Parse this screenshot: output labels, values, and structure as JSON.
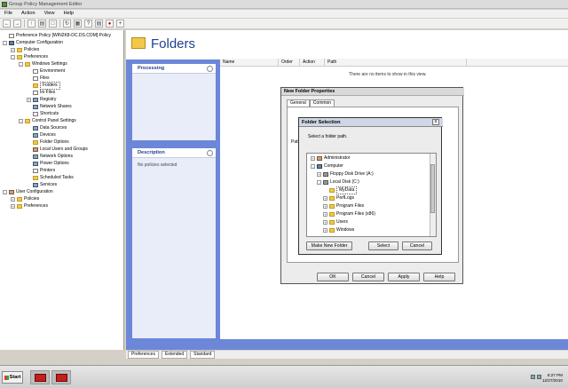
{
  "window": {
    "title": "Group Policy Management Editor"
  },
  "menu": [
    "File",
    "Action",
    "View",
    "Help"
  ],
  "toolbar_icons": [
    "back-icon",
    "forward-icon",
    "up-icon",
    "show-hide-tree-icon",
    "properties-icon",
    "refresh-icon",
    "export-icon",
    "help-icon",
    "filter-icon",
    "stop-icon",
    "add-icon"
  ],
  "tree": [
    {
      "label": "Preference Policy [WIN2K8-DC.DS.COM] Policy",
      "level": 0,
      "icon": "doc"
    },
    {
      "label": "Computer Configuration",
      "level": 0,
      "icon": "pc",
      "exp": "-"
    },
    {
      "label": "Policies",
      "level": 1,
      "icon": "fold",
      "exp": "+"
    },
    {
      "label": "Preferences",
      "level": 1,
      "icon": "fold",
      "exp": "-"
    },
    {
      "label": "Windows Settings",
      "level": 2,
      "icon": "fold",
      "exp": "-"
    },
    {
      "label": "Environment",
      "level": 3,
      "icon": "doc"
    },
    {
      "label": "Files",
      "level": 3,
      "icon": "doc"
    },
    {
      "label": "Folders",
      "level": 3,
      "icon": "fold",
      "selected": true
    },
    {
      "label": "Ini Files",
      "level": 3,
      "icon": "doc"
    },
    {
      "label": "Registry",
      "level": 3,
      "icon": "gear",
      "exp": "+"
    },
    {
      "label": "Network Shares",
      "level": 3,
      "icon": "gear"
    },
    {
      "label": "Shortcuts",
      "level": 3,
      "icon": "doc"
    },
    {
      "label": "Control Panel Settings",
      "level": 2,
      "icon": "fold",
      "exp": "-"
    },
    {
      "label": "Data Sources",
      "level": 3,
      "icon": "gear"
    },
    {
      "label": "Devices",
      "level": 3,
      "icon": "gear"
    },
    {
      "label": "Folder Options",
      "level": 3,
      "icon": "fold"
    },
    {
      "label": "Local Users and Groups",
      "level": 3,
      "icon": "user"
    },
    {
      "label": "Network Options",
      "level": 3,
      "icon": "gear"
    },
    {
      "label": "Power Options",
      "level": 3,
      "icon": "gear"
    },
    {
      "label": "Printers",
      "level": 3,
      "icon": "doc"
    },
    {
      "label": "Scheduled Tasks",
      "level": 3,
      "icon": "fold"
    },
    {
      "label": "Services",
      "level": 3,
      "icon": "gear"
    },
    {
      "label": "User Configuration",
      "level": 0,
      "icon": "user",
      "exp": "-"
    },
    {
      "label": "Policies",
      "level": 1,
      "icon": "fold",
      "exp": "+"
    },
    {
      "label": "Preferences",
      "level": 1,
      "icon": "fold",
      "exp": "+"
    }
  ],
  "header": {
    "title": "Folders"
  },
  "panels": {
    "processing": "Processing",
    "description": "Description",
    "description_text": "No policies selected"
  },
  "list": {
    "columns": [
      "Name",
      "Order",
      "Action",
      "Path"
    ],
    "empty_text": "There are no items to show in this view."
  },
  "bottom_tabs": [
    "Preferences",
    "Extended",
    "Standard"
  ],
  "props_dialog": {
    "title": "New Folder Properties",
    "tabs": [
      "General",
      "Common"
    ],
    "path_label": "Path",
    "buttons": [
      "OK",
      "Cancel",
      "Apply",
      "Help"
    ]
  },
  "folder_dialog": {
    "title": "Folder Selection",
    "close": "x",
    "prompt": "Select a folder path.",
    "tree": [
      {
        "label": "Administrator",
        "level": 0,
        "icon": "user",
        "exp": "+"
      },
      {
        "label": "Computer",
        "level": 0,
        "icon": "pc",
        "exp": "-"
      },
      {
        "label": "Floppy Disk Drive (A:)",
        "level": 1,
        "icon": "disk",
        "exp": "+"
      },
      {
        "label": "Local Disk (C:)",
        "level": 1,
        "icon": "disk",
        "exp": "-"
      },
      {
        "label": "MyData",
        "level": 2,
        "icon": "fold",
        "selected": true
      },
      {
        "label": "PerfLogs",
        "level": 2,
        "icon": "fold",
        "exp": "+"
      },
      {
        "label": "Program Files",
        "level": 2,
        "icon": "fold",
        "exp": "+"
      },
      {
        "label": "Program Files (x86)",
        "level": 2,
        "icon": "fold",
        "exp": "+"
      },
      {
        "label": "Users",
        "level": 2,
        "icon": "fold",
        "exp": "+"
      },
      {
        "label": "Windows",
        "level": 2,
        "icon": "fold",
        "exp": "+"
      }
    ],
    "buttons": {
      "make_new": "Make New Folder",
      "select": "Select",
      "cancel": "Cancel"
    }
  },
  "taskbar": {
    "start": "Start",
    "time": "8:27 PM",
    "date": "12/27/2010"
  }
}
